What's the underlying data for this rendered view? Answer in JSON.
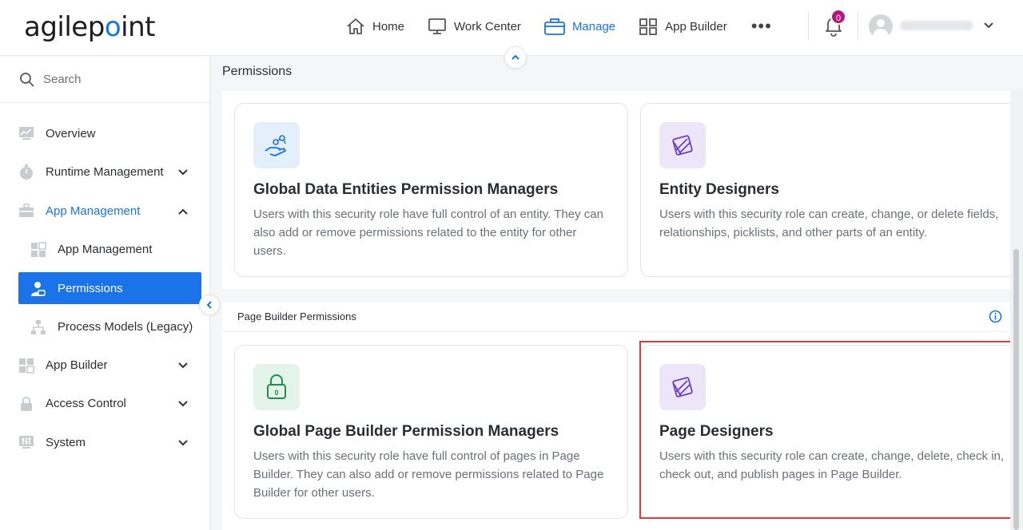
{
  "header": {
    "logo_text_a": "agilep",
    "logo_text_dot": "o",
    "logo_text_b": "int",
    "nav": [
      {
        "label": "Home",
        "icon": "home-icon"
      },
      {
        "label": "Work Center",
        "icon": "monitor-icon"
      },
      {
        "label": "Manage",
        "icon": "briefcase-icon",
        "active": true
      },
      {
        "label": "App Builder",
        "icon": "grid-icon"
      }
    ],
    "more_label": "•••",
    "notification_count": "0"
  },
  "sidebar": {
    "search_placeholder": "Search",
    "items": [
      {
        "label": "Overview",
        "icon": "chart-icon"
      },
      {
        "label": "Runtime Management",
        "icon": "stopwatch-icon",
        "expandable": true
      },
      {
        "label": "App Management",
        "icon": "toolbox-icon",
        "expanded": true
      },
      {
        "label": "App Management",
        "icon": "apps-icon",
        "sub": true
      },
      {
        "label": "Permissions",
        "icon": "user-lock-icon",
        "sub": true,
        "selected": true
      },
      {
        "label": "Process Models (Legacy)",
        "icon": "hierarchy-icon",
        "sub": true
      },
      {
        "label": "App Builder",
        "icon": "grid-icon",
        "expandable": true
      },
      {
        "label": "Access Control",
        "icon": "lock-icon",
        "expandable": true
      },
      {
        "label": "System",
        "icon": "sliders-icon",
        "expandable": true
      }
    ]
  },
  "main": {
    "page_title": "Permissions",
    "section1": {
      "cards": [
        {
          "title": "Global Data Entities Permission Managers",
          "desc": "Users with this security role have full control of an entity. They can also add or remove permissions related to the entity for other users."
        },
        {
          "title": "Entity Designers",
          "desc": "Users with this security role can create, change, or delete fields, relationships, picklists, and other parts of an entity."
        }
      ]
    },
    "section2": {
      "title": "Page Builder Permissions",
      "cards": [
        {
          "title": "Global Page Builder Permission Managers",
          "desc": "Users with this security role have full control of pages in Page Builder. They can also add or remove permissions related to Page Builder for other users."
        },
        {
          "title": "Page Designers",
          "desc": "Users with this security role can create, change, delete, check in, check out, and publish pages in Page Builder."
        }
      ]
    }
  },
  "colors": {
    "accent": "#1a73e8",
    "badge": "#b5177a",
    "highlight": "#e53935",
    "icon_blue_bg": "#e3f0fb",
    "icon_purple_bg": "#ece6f8",
    "icon_green_bg": "#e4f4ea"
  }
}
